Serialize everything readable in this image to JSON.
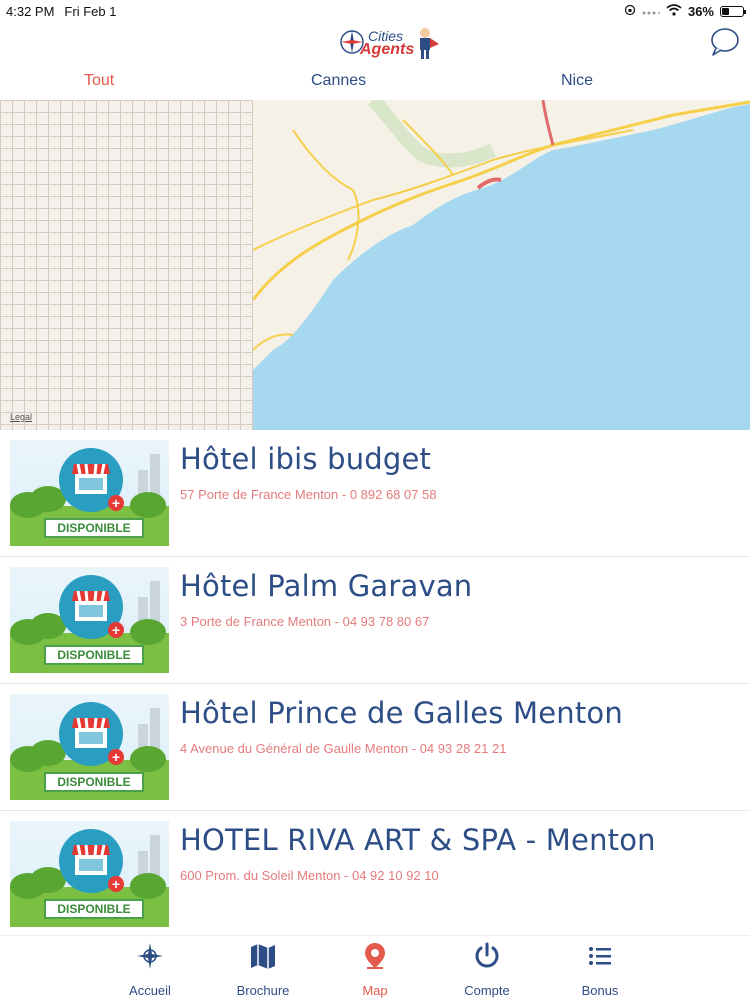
{
  "status": {
    "time": "4:32 PM",
    "date": "Fri Feb 1",
    "battery": "36%",
    "battery_level": 0.36
  },
  "header": {
    "logo_top": "Cities",
    "logo_bottom": "Agents"
  },
  "tabs": [
    {
      "label": "Tout",
      "active": true
    },
    {
      "label": "Cannes",
      "active": false
    },
    {
      "label": "Nice",
      "active": false
    }
  ],
  "map": {
    "legal": "Legal"
  },
  "listings": [
    {
      "name": "Hôtel ibis budget",
      "address": "57 Porte de France Menton - 0 892 68 07 58",
      "status": "DISPONIBLE"
    },
    {
      "name": "Hôtel Palm Garavan",
      "address": "3 Porte de France Menton - 04 93 78 80 67",
      "status": "DISPONIBLE"
    },
    {
      "name": "Hôtel Prince de Galles Menton",
      "address": "4 Avenue du Général de Gaulle Menton - 04 93 28 21 21",
      "status": "DISPONIBLE"
    },
    {
      "name": "HOTEL RIVA ART & SPA - Menton",
      "address": "600 Prom. du Soleil Menton - 04 92 10 92 10",
      "status": "DISPONIBLE"
    }
  ],
  "nav": [
    {
      "label": "Accueil",
      "icon": "compass-icon",
      "active": false
    },
    {
      "label": "Brochure",
      "icon": "map-fold-icon",
      "active": false
    },
    {
      "label": "Map",
      "icon": "map-pin-icon",
      "active": true
    },
    {
      "label": "Compte",
      "icon": "power-icon",
      "active": false
    },
    {
      "label": "Bonus",
      "icon": "list-icon",
      "active": false
    }
  ],
  "colors": {
    "primary": "#2d4d86",
    "accent": "#e35a4c",
    "address": "#e57b7b",
    "sea": "#a6d8f0",
    "land": "#f6f1e7",
    "road": "#f6cf4a"
  }
}
